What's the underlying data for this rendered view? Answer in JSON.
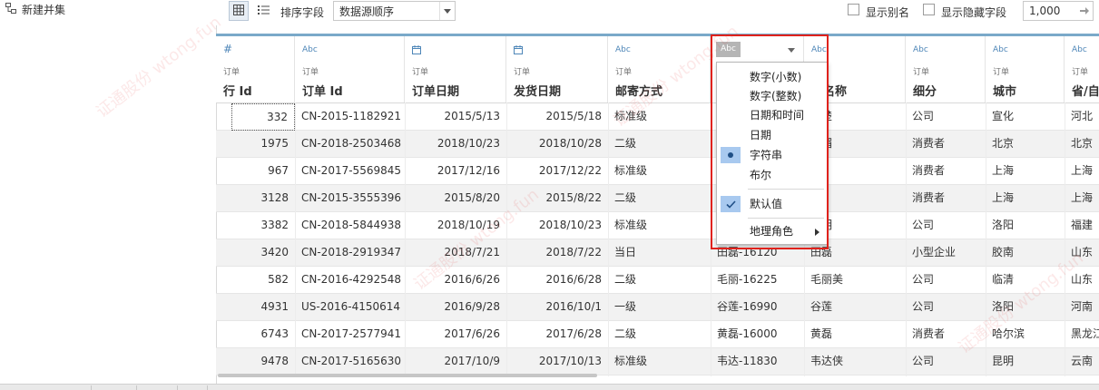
{
  "left_panel": {
    "item_label": "新建并集"
  },
  "toolbar": {
    "sort_label": "排序字段",
    "sort_value": "数据源顺序",
    "show_alias_label": "显示别名",
    "show_hidden_label": "显示隐藏字段",
    "row_count": "1,000"
  },
  "columns": [
    {
      "type": "#",
      "source": "订单",
      "name": "行 Id"
    },
    {
      "type": "Abc",
      "source": "订单",
      "name": "订单 Id"
    },
    {
      "type": "date-icon",
      "source": "订单",
      "name": "订单日期"
    },
    {
      "type": "date-icon",
      "source": "订单",
      "name": "发货日期"
    },
    {
      "type": "Abc",
      "source": "订单",
      "name": "邮寄方式"
    },
    {
      "type": "Abc",
      "source": "",
      "name": ""
    },
    {
      "type": "Abc",
      "source": "",
      "name": "户名称"
    },
    {
      "type": "Abc",
      "source": "订单",
      "name": "细分"
    },
    {
      "type": "Abc",
      "source": "订单",
      "name": "城市"
    },
    {
      "type": "Abc",
      "source": "订单",
      "name": "省/自"
    }
  ],
  "rows": [
    [
      "332",
      "CN-2015-1182921",
      "2015/5/13",
      "2015/5/18",
      "标准级",
      "",
      "楚楚",
      "公司",
      "宣化",
      "河北"
    ],
    [
      "1975",
      "CN-2018-2503468",
      "2018/10/23",
      "2018/10/28",
      "二级",
      "",
      "娟媚",
      "消费者",
      "北京",
      "北京"
    ],
    [
      "967",
      "CN-2017-5569845",
      "2017/12/16",
      "2017/12/22",
      "标准级",
      "",
      "磊",
      "消费者",
      "上海",
      "上海"
    ],
    [
      "3128",
      "CN-2015-3555396",
      "2015/8/20",
      "2015/8/22",
      "二级",
      "",
      "骞",
      "消费者",
      "上海",
      "上海"
    ],
    [
      "3382",
      "CN-2018-5844938",
      "2018/10/19",
      "2018/10/23",
      "标准级",
      "",
      "黎明",
      "公司",
      "洛阳",
      "福建"
    ],
    [
      "3420",
      "CN-2018-2919347",
      "2018/7/21",
      "2018/7/22",
      "当日",
      "田磊-16120",
      "田磊",
      "小型企业",
      "胶南",
      "山东"
    ],
    [
      "582",
      "CN-2016-4292548",
      "2016/6/26",
      "2016/6/28",
      "二级",
      "毛丽-16225",
      "毛丽美",
      "公司",
      "临清",
      "山东"
    ],
    [
      "4931",
      "US-2016-4150614",
      "2016/9/28",
      "2016/10/1",
      "一级",
      "谷莲-16990",
      "谷莲",
      "公司",
      "洛阳",
      "河南"
    ],
    [
      "6743",
      "CN-2017-2577941",
      "2017/6/26",
      "2017/6/28",
      "二级",
      "黄磊-16000",
      "黄磊",
      "消费者",
      "哈尔滨",
      "黑龙江"
    ],
    [
      "9478",
      "CN-2017-5165630",
      "2017/10/9",
      "2017/10/13",
      "标准级",
      "韦达-11830",
      "韦达侠",
      "公司",
      "昆明",
      "云南"
    ]
  ],
  "type_menu": {
    "anchor_label": "Abc",
    "items": [
      "数字(小数)",
      "数字(整数)",
      "日期和时间",
      "日期",
      "字符串",
      "布尔"
    ],
    "selected_index": 4,
    "default_label": "默认值",
    "geo_label": "地理角色"
  },
  "watermark": "证通股份 wtong.fun",
  "colors": {
    "accent": "#7aa9c9",
    "highlight": "#a8c9ef",
    "annotation": "#e0221c"
  }
}
